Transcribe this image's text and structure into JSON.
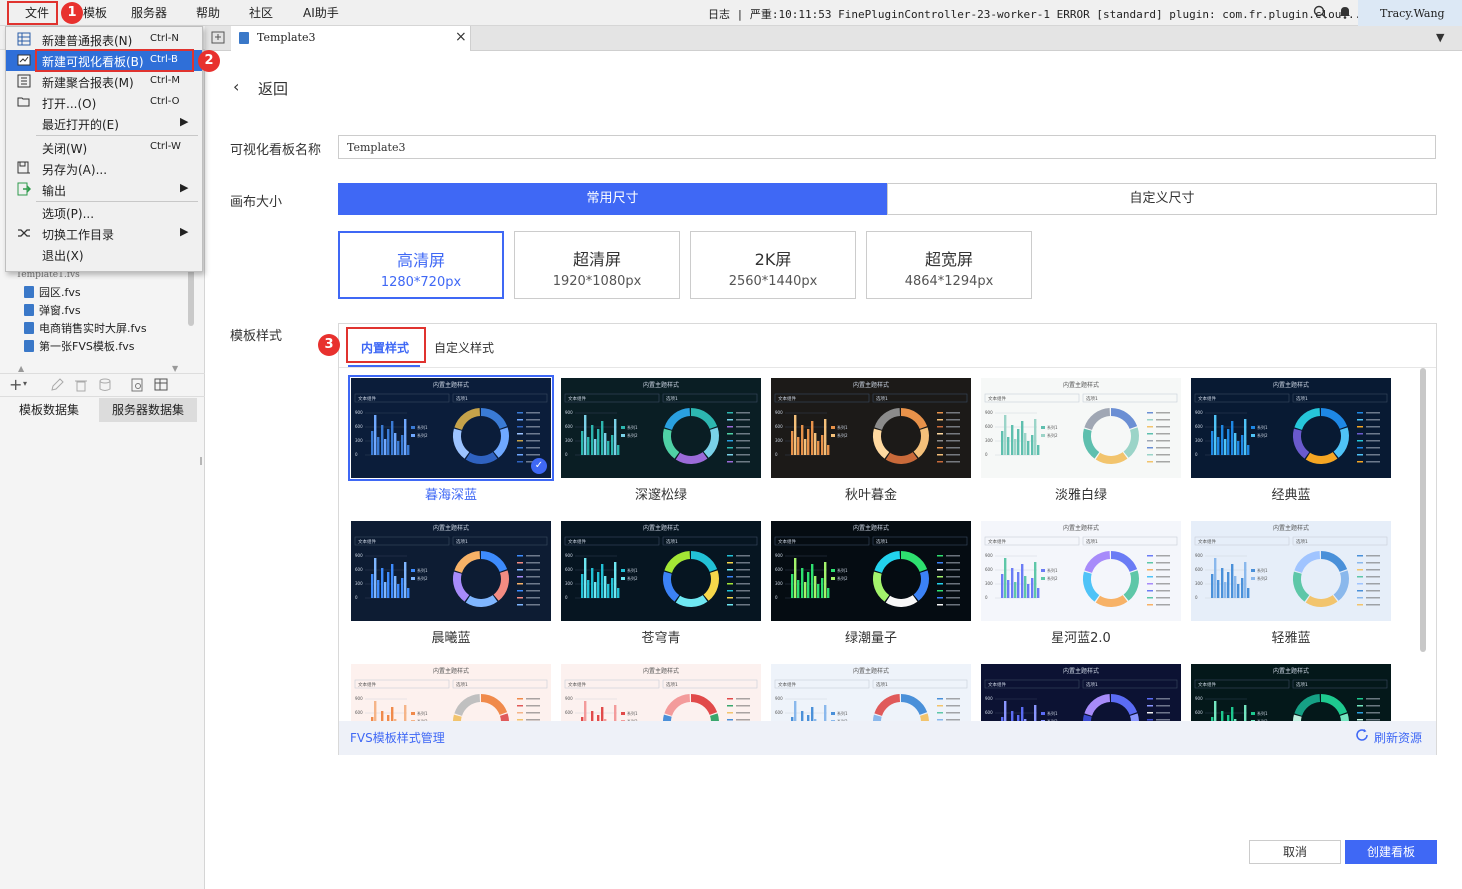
{
  "menubar": {
    "items": [
      "文件",
      "模板",
      "服务器",
      "帮助",
      "社区",
      "AI助手"
    ],
    "log_text": "日志 | 严重:10:11:53 FinePluginController-23-worker-1 ERROR [standard] plugin: com.fr.plugin.clou...",
    "user": "Tracy.Wang"
  },
  "file_menu": {
    "items": [
      {
        "label": "新建普通报表(N)",
        "shortcut": "Ctrl-N",
        "icon": "grid-report-icon"
      },
      {
        "label": "新建可视化看板(B)",
        "shortcut": "Ctrl-B",
        "icon": "dashboard-icon"
      },
      {
        "label": "新建聚合报表(M)",
        "shortcut": "Ctrl-M",
        "icon": "aggregate-report-icon"
      },
      {
        "label": "打开...(O)",
        "shortcut": "Ctrl-O",
        "icon": "folder-open-icon"
      },
      {
        "label": "最近打开的(E)",
        "shortcut": "",
        "icon": ""
      },
      {
        "label": "关闭(W)",
        "shortcut": "Ctrl-W",
        "icon": ""
      },
      {
        "label": "另存为(A)...",
        "shortcut": "",
        "icon": "save-as-icon"
      },
      {
        "label": "输出",
        "shortcut": "",
        "icon": "export-icon"
      },
      {
        "label": "选项(P)...",
        "shortcut": "",
        "icon": ""
      },
      {
        "label": "切换工作目录",
        "shortcut": "",
        "icon": "switch-icon"
      },
      {
        "label": "退出(X)",
        "shortcut": "",
        "icon": ""
      }
    ]
  },
  "callouts": [
    "1",
    "2",
    "3"
  ],
  "tree": {
    "items": [
      "园区.fvs",
      "弹窗.fvs",
      "电商销售实时大屏.fvs",
      "第一张FVS模板.fvs"
    ]
  },
  "dataset_tabs": [
    "模板数据集",
    "服务器数据集"
  ],
  "tab": {
    "title": "Template3"
  },
  "back_label": "返回",
  "form": {
    "name_label": "可视化看板名称",
    "name_value": "Template3",
    "canvas_label": "画布大小",
    "size_tabs": [
      "常用尺寸",
      "自定义尺寸"
    ],
    "sizes": [
      {
        "title": "高清屏",
        "size": "1280*720px"
      },
      {
        "title": "超清屏",
        "size": "1920*1080px"
      },
      {
        "title": "2K屏",
        "size": "2560*1440px"
      },
      {
        "title": "超宽屏",
        "size": "4864*1294px"
      }
    ],
    "style_label": "模板样式",
    "style_tabs": [
      "内置样式",
      "自定义样式"
    ]
  },
  "thumb_text": {
    "title": "内置主题样式",
    "filter": "文本组件",
    "select": "选项1",
    "y_ticks": [
      "900",
      "600",
      "300",
      "0"
    ],
    "series": [
      "系列1",
      "系列2"
    ]
  },
  "themes": [
    {
      "name": "暮海深蓝",
      "bg": "#0b1d3a",
      "bars": [
        "#3a7bd5",
        "#6fa8ff"
      ],
      "ring": [
        "#3a7bd5",
        "#6fa8ff",
        "#2f62c0",
        "#9cc3ff",
        "#c5a24a"
      ]
    },
    {
      "name": "深邃松绿",
      "bg": "#0a1e24",
      "bars": [
        "#2db7b0",
        "#7ad1e8"
      ],
      "ring": [
        "#2db7b0",
        "#7ad1e8",
        "#9b6bd9",
        "#4fd1a5",
        "#2aa0e0"
      ]
    },
    {
      "name": "秋叶暮金",
      "bg": "#1c1a18",
      "bars": [
        "#e8924a",
        "#f4c07a"
      ],
      "ring": [
        "#e8924a",
        "#f4c07a",
        "#c96a3a",
        "#ffd9a0",
        "#8b8b8b"
      ]
    },
    {
      "name": "淡雅白绿",
      "bg": "#f6f8f7",
      "bars": [
        "#5ebfae",
        "#9bd4c8"
      ],
      "ring": [
        "#6b8fd4",
        "#9bd4c8",
        "#f2c46d",
        "#5ebfae",
        "#a0a7b4"
      ]
    },
    {
      "name": "经典蓝",
      "bg": "#081a33",
      "bars": [
        "#1e88e5",
        "#4fc3f7"
      ],
      "ring": [
        "#1e88e5",
        "#4fc3f7",
        "#f5a623",
        "#6a5acd",
        "#26c6da"
      ]
    },
    {
      "name": "晨曦蓝",
      "bg": "#0d1c33",
      "bars": [
        "#3d8bfd",
        "#7fb6ff"
      ],
      "ring": [
        "#3d8bfd",
        "#f28b82",
        "#7fb6ff",
        "#a78bfa",
        "#f7b267"
      ]
    },
    {
      "name": "苍穹青",
      "bg": "#061521",
      "bars": [
        "#22c1d6",
        "#6ee7f2"
      ],
      "ring": [
        "#22c1d6",
        "#f6d74a",
        "#6ee7f2",
        "#3b82f6",
        "#a3e635"
      ]
    },
    {
      "name": "绿潮量子",
      "bg": "#050c12",
      "bars": [
        "#2ee06f",
        "#a3f36b"
      ],
      "ring": [
        "#2ee06f",
        "#3b82f6",
        "#f8f8f8",
        "#a3f36b",
        "#22d3ee"
      ]
    },
    {
      "name": "星河蓝2.0",
      "bg": "#f4f6fb",
      "bars": [
        "#6b7cf5",
        "#5ec7a8"
      ],
      "ring": [
        "#6b7cf5",
        "#5ec7a8",
        "#f7b267",
        "#4fc3f7",
        "#a78bfa"
      ]
    },
    {
      "name": "轻雅蓝",
      "bg": "#e6eef9",
      "bars": [
        "#4a90d9",
        "#8ab8ec"
      ],
      "ring": [
        "#4a90d9",
        "#8ab8ec",
        "#f2c46d",
        "#5ec7a8",
        "#a0c4ff"
      ]
    },
    {
      "name": "",
      "bg": "#fdf1ee",
      "bars": [
        "#f08a4b",
        "#f5b488"
      ],
      "ring": [
        "#f08a4b",
        "#e05a5a",
        "#f5b488",
        "#f2c46d",
        "#c0c0c0"
      ]
    },
    {
      "name": "",
      "bg": "#fcf1ef",
      "bars": [
        "#e14a4a",
        "#f39b9b"
      ],
      "ring": [
        "#e14a4a",
        "#3aa76d",
        "#f2c46d",
        "#4a90d9",
        "#f39b9b"
      ]
    },
    {
      "name": "",
      "bg": "#eef3fa",
      "bars": [
        "#4a90d9",
        "#8ab8ec"
      ],
      "ring": [
        "#4a90d9",
        "#f2c46d",
        "#5ec7a8",
        "#8ab8ec",
        "#e05a5a"
      ]
    },
    {
      "name": "",
      "bg": "#0c1233",
      "bars": [
        "#5b6cf5",
        "#8a96ff"
      ],
      "ring": [
        "#5b6cf5",
        "#8a96ff",
        "#f2f2f2",
        "#3b4ad0",
        "#a78bfa"
      ]
    },
    {
      "name": "",
      "bg": "#04181a",
      "bars": [
        "#1ec98f",
        "#74e6c0"
      ],
      "ring": [
        "#1ec98f",
        "#74e6c0",
        "#2aa0e0",
        "#c0f0e0",
        "#16a085"
      ]
    }
  ],
  "selected_theme": 0,
  "footer": {
    "manage_link": "FVS模板样式管理",
    "refresh_label": "刷新资源"
  },
  "actions": {
    "cancel": "取消",
    "create": "创建看板"
  },
  "colors": {
    "accent": "#3f68f5",
    "callout": "#e8312e"
  }
}
